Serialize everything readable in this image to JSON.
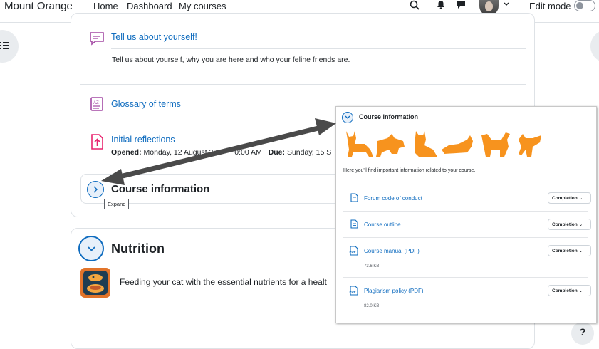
{
  "navbar": {
    "brand": "Mount Orange",
    "links": [
      "Home",
      "Dashboard",
      "My courses"
    ],
    "edit_mode_label": "Edit mode",
    "edit_mode_on": false
  },
  "activities": [
    {
      "title": "Tell us about yourself!",
      "description": "Tell us about yourself, why you are here and who your feline friends are.",
      "icon": "forum-icon"
    },
    {
      "title": "Glossary of terms",
      "icon": "glossary-icon"
    },
    {
      "title": "Initial reflections",
      "icon": "assignment-icon",
      "opened_label": "Opened:",
      "opened_value": "Monday, 12 August 20",
      "opened_tail": "0:00 AM",
      "due_label": "Due:",
      "due_value": "Sunday, 15 S"
    }
  ],
  "sections": {
    "course_information": {
      "title": "Course information",
      "expand_tooltip": "Expand"
    },
    "nutrition": {
      "title": "Nutrition",
      "description": "Feeding your cat with the essential nutrients for a healt"
    }
  },
  "popup": {
    "title": "Course information",
    "summary": "Here you'll find important information related to your course.",
    "items": [
      {
        "title": "Forum code of conduct",
        "icon": "page-icon",
        "completion": "Completion"
      },
      {
        "title": "Course outline",
        "icon": "page-icon",
        "completion": "Completion"
      },
      {
        "title": "Course manual (PDF)",
        "icon": "pdf-icon",
        "completion": "Completion",
        "size": "73.6 KB"
      },
      {
        "title": "Plagiarism policy (PDF)",
        "icon": "pdf-icon",
        "completion": "Completion",
        "size": "82.0 KB"
      }
    ],
    "banner_color": "#f7931e"
  },
  "help_label": "?",
  "colors": {
    "link": "#0f6cbf",
    "arrow": "#4a4a4a",
    "cat": "#f7931e"
  }
}
